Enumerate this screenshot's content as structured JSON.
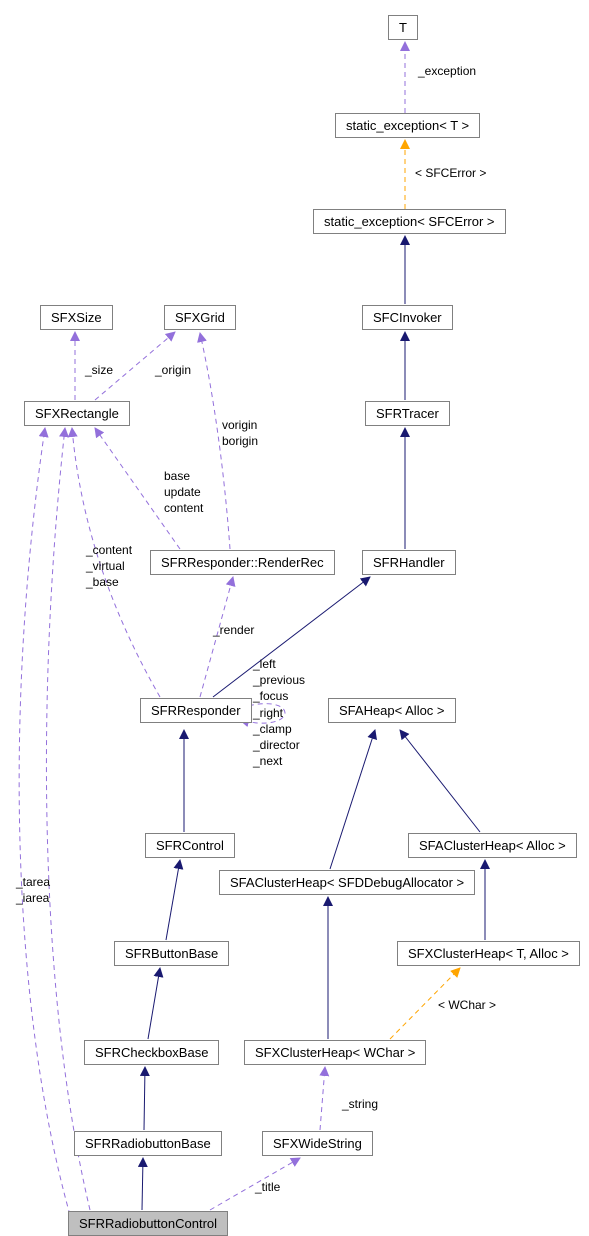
{
  "chart_data": {
    "type": "graph",
    "title": "",
    "nodes": [
      {
        "id": "T",
        "label": "T"
      },
      {
        "id": "static_exception_T",
        "label": "static_exception< T >"
      },
      {
        "id": "static_exception_SFCErr",
        "label": "static_exception< SFCError >"
      },
      {
        "id": "SFCInvoker",
        "label": "SFCInvoker"
      },
      {
        "id": "SFRTracer",
        "label": "SFRTracer"
      },
      {
        "id": "SFRHandler",
        "label": "SFRHandler"
      },
      {
        "id": "SFRResponder",
        "label": "SFRResponder"
      },
      {
        "id": "SFRControl",
        "label": "SFRControl"
      },
      {
        "id": "SFRButtonBase",
        "label": "SFRButtonBase"
      },
      {
        "id": "SFRCheckboxBase",
        "label": "SFRCheckboxBase"
      },
      {
        "id": "SFRRadiobuttonBase",
        "label": "SFRRadiobuttonBase"
      },
      {
        "id": "SFRRadiobuttonControl",
        "label": "SFRRadiobuttonControl",
        "highlight": true
      },
      {
        "id": "SFRResponder_RenderRec",
        "label": "SFRResponder::RenderRec"
      },
      {
        "id": "SFXSize",
        "label": "SFXSize"
      },
      {
        "id": "SFXGrid",
        "label": "SFXGrid"
      },
      {
        "id": "SFXRectangle",
        "label": "SFXRectangle"
      },
      {
        "id": "SFAHeap_Alloc",
        "label": "SFAHeap< Alloc >"
      },
      {
        "id": "SFAClusterHeap_Alloc",
        "label": "SFAClusterHeap< Alloc >"
      },
      {
        "id": "SFAClusterHeap_DbgAlloc",
        "label": "SFAClusterHeap< SFDDebugAllocator >"
      },
      {
        "id": "SFXClusterHeap_TAlloc",
        "label": "SFXClusterHeap< T, Alloc >"
      },
      {
        "id": "SFXClusterHeap_WChar",
        "label": "SFXClusterHeap< WChar >"
      },
      {
        "id": "SFXWideString",
        "label": "SFXWideString"
      }
    ],
    "edges": [
      {
        "from": "static_exception_T",
        "to": "T",
        "style": "dashed",
        "color": "purple",
        "label": "_exception"
      },
      {
        "from": "static_exception_SFCErr",
        "to": "static_exception_T",
        "style": "dashed",
        "color": "orange",
        "label": "< SFCError >"
      },
      {
        "from": "SFCInvoker",
        "to": "static_exception_SFCErr",
        "style": "solid",
        "color": "navy"
      },
      {
        "from": "SFRTracer",
        "to": "SFCInvoker",
        "style": "solid",
        "color": "navy"
      },
      {
        "from": "SFRHandler",
        "to": "SFRTracer",
        "style": "solid",
        "color": "navy"
      },
      {
        "from": "SFRResponder",
        "to": "SFRHandler",
        "style": "solid",
        "color": "navy"
      },
      {
        "from": "SFRResponder",
        "to": "SFRResponder_RenderRec",
        "style": "dashed",
        "color": "purple",
        "label": "_render"
      },
      {
        "from": "SFRResponder",
        "to": "SFRResponder",
        "style": "dashed",
        "color": "purple",
        "label": "_left\n_previous\n_focus\n_right\n_clamp\n_director\n_next"
      },
      {
        "from": "SFRResponder",
        "to": "SFXRectangle",
        "style": "dashed",
        "color": "purple",
        "label": "_content\n_virtual\n_base"
      },
      {
        "from": "SFRResponder_RenderRec",
        "to": "SFXRectangle",
        "style": "dashed",
        "color": "purple",
        "label": "base\nupdate\ncontent"
      },
      {
        "from": "SFRResponder_RenderRec",
        "to": "SFXGrid",
        "style": "dashed",
        "color": "purple",
        "label": "vorigin\nborigin"
      },
      {
        "from": "SFXRectangle",
        "to": "SFXSize",
        "style": "dashed",
        "color": "purple",
        "label": "_size"
      },
      {
        "from": "SFXRectangle",
        "to": "SFXGrid",
        "style": "dashed",
        "color": "purple",
        "label": "_origin"
      },
      {
        "from": "SFRControl",
        "to": "SFRResponder",
        "style": "solid",
        "color": "navy"
      },
      {
        "from": "SFRButtonBase",
        "to": "SFRControl",
        "style": "solid",
        "color": "navy"
      },
      {
        "from": "SFRCheckboxBase",
        "to": "SFRButtonBase",
        "style": "solid",
        "color": "navy"
      },
      {
        "from": "SFRRadiobuttonBase",
        "to": "SFRCheckboxBase",
        "style": "solid",
        "color": "navy"
      },
      {
        "from": "SFRRadiobuttonControl",
        "to": "SFRRadiobuttonBase",
        "style": "solid",
        "color": "navy"
      },
      {
        "from": "SFRRadiobuttonControl",
        "to": "SFXWideString",
        "style": "dashed",
        "color": "purple",
        "label": "_title"
      },
      {
        "from": "SFRRadiobuttonControl",
        "to": "SFXRectangle",
        "style": "dashed",
        "color": "purple",
        "label": "_tarea\n_iarea"
      },
      {
        "from": "SFXWideString",
        "to": "SFXClusterHeap_WChar",
        "style": "dashed",
        "color": "purple",
        "label": "_string"
      },
      {
        "from": "SFXClusterHeap_WChar",
        "to": "SFXClusterHeap_TAlloc",
        "style": "dashed",
        "color": "orange",
        "label": "< WChar >"
      },
      {
        "from": "SFXClusterHeap_WChar",
        "to": "SFAClusterHeap_DbgAlloc",
        "style": "solid",
        "color": "navy"
      },
      {
        "from": "SFXClusterHeap_TAlloc",
        "to": "SFAClusterHeap_Alloc",
        "style": "solid",
        "color": "navy"
      },
      {
        "from": "SFAClusterHeap_Alloc",
        "to": "SFAHeap_Alloc",
        "style": "solid",
        "color": "navy"
      },
      {
        "from": "SFAClusterHeap_DbgAlloc",
        "to": "SFAHeap_Alloc",
        "style": "solid",
        "color": "navy"
      }
    ]
  },
  "nodes": {
    "T": "T",
    "static_exception_T": "static_exception< T >",
    "static_exception_SFCErr": "static_exception< SFCError >",
    "SFCInvoker": "SFCInvoker",
    "SFRTracer": "SFRTracer",
    "SFRHandler": "SFRHandler",
    "SFRResponder": "SFRResponder",
    "SFRControl": "SFRControl",
    "SFRButtonBase": "SFRButtonBase",
    "SFRCheckboxBase": "SFRCheckboxBase",
    "SFRRadiobuttonBase": "SFRRadiobuttonBase",
    "SFRRadiobuttonControl": "SFRRadiobuttonControl",
    "SFRResponder_RenderRec": "SFRResponder::RenderRec",
    "SFXSize": "SFXSize",
    "SFXGrid": "SFXGrid",
    "SFXRectangle": "SFXRectangle",
    "SFAHeap_Alloc": "SFAHeap< Alloc >",
    "SFAClusterHeap_Alloc": "SFAClusterHeap< Alloc >",
    "SFAClusterHeap_DbgAlloc": "SFAClusterHeap< SFDDebugAllocator >",
    "SFXClusterHeap_TAlloc": "SFXClusterHeap< T, Alloc >",
    "SFXClusterHeap_WChar": "SFXClusterHeap< WChar >",
    "SFXWideString": "SFXWideString"
  },
  "labels": {
    "exception": "_exception",
    "sfcerror": "< SFCError >",
    "size": "_size",
    "origin": "_origin",
    "vorigin_borigin": "vorigin\nborigin",
    "base_update_content": "base\nupdate\ncontent",
    "content_virtual_base": "_content\n_virtual\n_base",
    "render": "_render",
    "selfloop": "_left\n_previous\n_focus\n_right\n_clamp\n_director\n_next",
    "tarea_iarea": "_tarea\n_iarea",
    "title": "_title",
    "string": "_string",
    "wchar": "< WChar >"
  }
}
